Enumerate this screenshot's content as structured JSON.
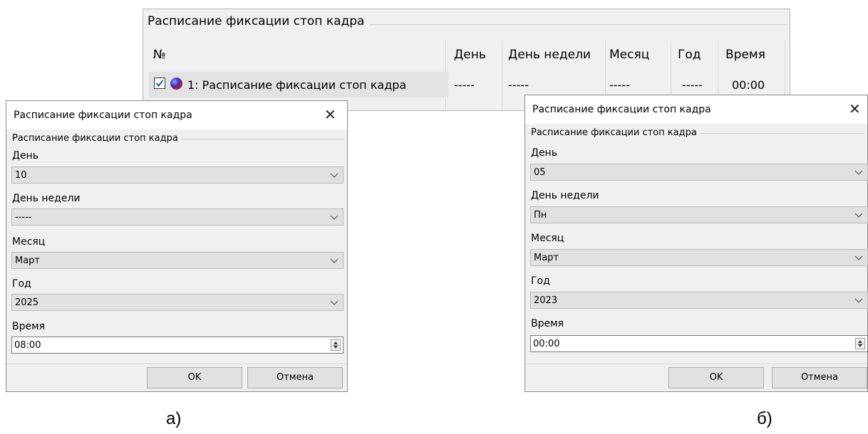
{
  "table": {
    "title": "Расписание фиксации стоп кадра",
    "columns": [
      "№",
      "День",
      "День недели",
      "Месяц",
      "Год",
      "Время"
    ],
    "row": {
      "name": "1: Расписание фиксации стоп кадра",
      "day": "-----",
      "weekday": "-----",
      "month": "-----",
      "year": "-----",
      "time": "00:00",
      "checked": true
    }
  },
  "dialog_a": {
    "title": "Расписание фиксации стоп кадра",
    "group_title": "Расписание фиксации стоп кадра",
    "day_label": "День",
    "day_value": "10",
    "weekday_label": "День недели",
    "weekday_value": "-----",
    "month_label": "Месяц",
    "month_value": "Март",
    "year_label": "Год",
    "year_value": "2025",
    "time_label": "Время",
    "time_value": "08:00",
    "ok_label": "OK",
    "cancel_label": "Отмена"
  },
  "dialog_b": {
    "title": "Расписание фиксации стоп кадра",
    "group_title": "Расписание фиксации стоп кадра",
    "day_label": "День",
    "day_value": "05",
    "weekday_label": "День недели",
    "weekday_value": "Пн",
    "month_label": "Месяц",
    "month_value": "Март",
    "year_label": "Год",
    "year_value": "2023",
    "time_label": "Время",
    "time_value": "00:00",
    "ok_label": "OK",
    "cancel_label": "Отмена"
  },
  "captions": {
    "a": "а)",
    "b": "б)"
  },
  "icons": {
    "close": "close-icon",
    "dropdown": "chevron-down-icon",
    "check": "check-icon",
    "status": "status-ball-icon"
  }
}
